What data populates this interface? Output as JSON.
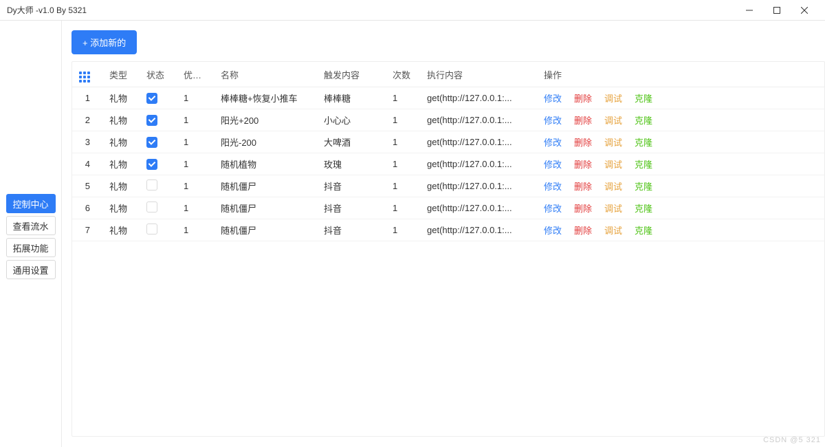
{
  "window": {
    "title": "Dy大师 -v1.0  By 5321"
  },
  "sidebar": {
    "items": [
      {
        "label": "控制中心",
        "active": true
      },
      {
        "label": "查看流水",
        "active": false
      },
      {
        "label": "拓展功能",
        "active": false
      },
      {
        "label": "通用设置",
        "active": false
      }
    ]
  },
  "toolbar": {
    "add_label": "+ 添加新的"
  },
  "table": {
    "headers": {
      "index": "",
      "type": "类型",
      "status": "状态",
      "priority": "优先级",
      "name": "名称",
      "trigger": "触发内容",
      "count": "次数",
      "exec": "执行内容",
      "actions": "操作"
    },
    "action_labels": {
      "edit": "修改",
      "delete": "删除",
      "debug": "调试",
      "clone": "克隆"
    },
    "rows": [
      {
        "idx": "1",
        "type": "礼物",
        "status": true,
        "priority": "1",
        "name": "棒棒糖+恢复小推车",
        "trigger": "棒棒糖",
        "count": "1",
        "exec": "get(http://127.0.0.1:..."
      },
      {
        "idx": "2",
        "type": "礼物",
        "status": true,
        "priority": "1",
        "name": "阳光+200",
        "trigger": "小心心",
        "count": "1",
        "exec": "get(http://127.0.0.1:..."
      },
      {
        "idx": "3",
        "type": "礼物",
        "status": true,
        "priority": "1",
        "name": "阳光-200",
        "trigger": "大啤酒",
        "count": "1",
        "exec": "get(http://127.0.0.1:..."
      },
      {
        "idx": "4",
        "type": "礼物",
        "status": true,
        "priority": "1",
        "name": "随机植物",
        "trigger": "玫瑰",
        "count": "1",
        "exec": "get(http://127.0.0.1:..."
      },
      {
        "idx": "5",
        "type": "礼物",
        "status": false,
        "priority": "1",
        "name": "随机僵尸",
        "trigger": "抖音",
        "count": "1",
        "exec": "get(http://127.0.0.1:..."
      },
      {
        "idx": "6",
        "type": "礼物",
        "status": false,
        "priority": "1",
        "name": "随机僵尸",
        "trigger": "抖音",
        "count": "1",
        "exec": "get(http://127.0.0.1:..."
      },
      {
        "idx": "7",
        "type": "礼物",
        "status": false,
        "priority": "1",
        "name": "随机僵尸",
        "trigger": "抖音",
        "count": "1",
        "exec": "get(http://127.0.0.1:..."
      }
    ]
  },
  "watermark": "CSDN @5 321"
}
